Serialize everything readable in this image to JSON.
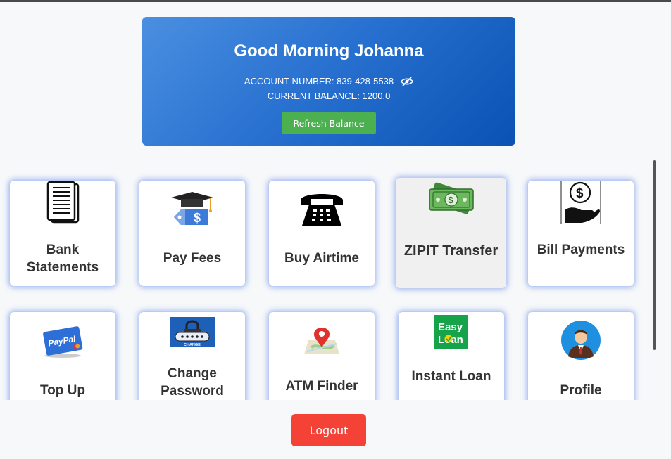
{
  "greeting": "Good Morning Johanna",
  "account": {
    "label": "ACCOUNT NUMBER: 839-428-5538",
    "balance": "CURRENT BALANCE: 1200.0"
  },
  "refresh_label": "Refresh Balance",
  "logout_label": "Logout",
  "tiles": [
    {
      "label": "Bank Statements",
      "icon": "notepad-icon"
    },
    {
      "label": "Pay Fees",
      "icon": "graduation-fee-icon"
    },
    {
      "label": "Buy Airtime",
      "icon": "telephone-icon"
    },
    {
      "label": "ZIPIT Transfer",
      "icon": "money-icon"
    },
    {
      "label": "Bill Payments",
      "icon": "hand-dollar-icon"
    },
    {
      "label": "Top Up",
      "icon": "paypal-card-icon"
    },
    {
      "label": "Change Password",
      "icon": "password-lock-icon"
    },
    {
      "label": "ATM Finder",
      "icon": "map-pin-icon"
    },
    {
      "label": "Instant Loan",
      "icon": "easy-loan-icon"
    },
    {
      "label": "Profile",
      "icon": "user-avatar-icon"
    }
  ],
  "logo_text": {
    "paypal": "PayPal",
    "easy": "Easy",
    "loan": "Loan",
    "change": "CHANGE"
  },
  "colors": {
    "accent_blue": "#2a72d1",
    "refresh_green": "#4caf50",
    "logout_red": "#f44336"
  }
}
